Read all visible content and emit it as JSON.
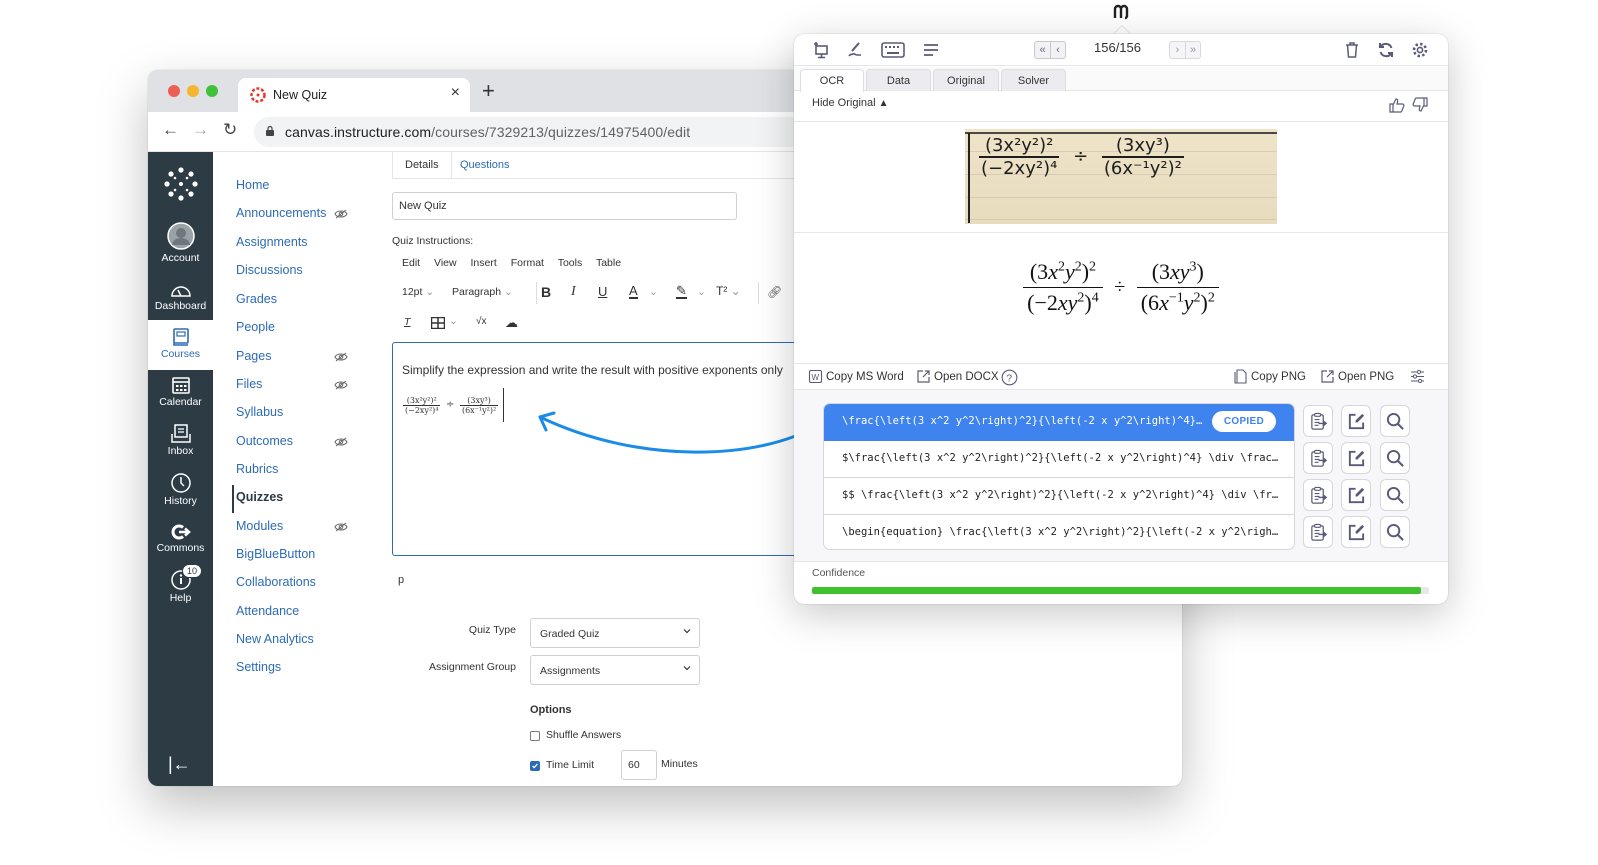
{
  "browser": {
    "tab_title": "New Quiz",
    "new_tab_symbol": "+",
    "close_symbol": "×",
    "url_domain": "canvas.instructure.com",
    "url_path": "/courses/7329213/quizzes/14975400/edit"
  },
  "global_nav": {
    "items": [
      {
        "label": "Account",
        "icon": "account-icon"
      },
      {
        "label": "Dashboard",
        "icon": "dashboard-icon"
      },
      {
        "label": "Courses",
        "icon": "courses-icon",
        "active": true
      },
      {
        "label": "Calendar",
        "icon": "calendar-icon"
      },
      {
        "label": "Inbox",
        "icon": "inbox-icon"
      },
      {
        "label": "History",
        "icon": "history-icon"
      },
      {
        "label": "Commons",
        "icon": "commons-icon"
      },
      {
        "label": "Help",
        "icon": "help-icon"
      }
    ],
    "help_badge": "10"
  },
  "course_nav": {
    "items": [
      {
        "label": "Home",
        "hidden": false
      },
      {
        "label": "Announcements",
        "hidden": true
      },
      {
        "label": "Assignments",
        "hidden": false
      },
      {
        "label": "Discussions",
        "hidden": false
      },
      {
        "label": "Grades",
        "hidden": false
      },
      {
        "label": "People",
        "hidden": false
      },
      {
        "label": "Pages",
        "hidden": true
      },
      {
        "label": "Files",
        "hidden": true
      },
      {
        "label": "Syllabus",
        "hidden": false
      },
      {
        "label": "Outcomes",
        "hidden": true
      },
      {
        "label": "Rubrics",
        "hidden": false
      },
      {
        "label": "Quizzes",
        "hidden": false,
        "active": true
      },
      {
        "label": "Modules",
        "hidden": true
      },
      {
        "label": "BigBlueButton",
        "hidden": false
      },
      {
        "label": "Collaborations",
        "hidden": false
      },
      {
        "label": "Attendance",
        "hidden": false
      },
      {
        "label": "New Analytics",
        "hidden": false
      },
      {
        "label": "Settings",
        "hidden": false
      }
    ]
  },
  "quiz_editor": {
    "tabs": [
      "Details",
      "Questions"
    ],
    "title_value": "New Quiz",
    "instructions_label": "Quiz Instructions:",
    "menu": [
      "Edit",
      "View",
      "Insert",
      "Format",
      "Tools",
      "Table"
    ],
    "font_size": "12pt",
    "block_format": "Paragraph",
    "body_text": "Simplify the expression and write the result with positive exponents only",
    "math": {
      "num1": "(3x²y²)²",
      "den1": "(−2xy²)⁴",
      "op": "÷",
      "num2": "(3xy³)",
      "den2": "(6x⁻¹y²)²"
    },
    "status_path": "p",
    "quiz_type_label": "Quiz Type",
    "quiz_type_value": "Graded Quiz",
    "assignment_group_label": "Assignment Group",
    "assignment_group_value": "Assignments",
    "options_heading": "Options",
    "shuffle_label": "Shuffle Answers",
    "shuffle_checked": false,
    "time_limit_label": "Time Limit",
    "time_limit_checked": true,
    "time_limit_value": "60",
    "minutes_label": "Minutes"
  },
  "snip": {
    "pager": "156/156",
    "tabs": [
      "OCR",
      "Data",
      "Original",
      "Solver"
    ],
    "active_tab": "OCR",
    "hide_original": "Hide Original",
    "actions": {
      "copy_word": "Copy MS Word",
      "open_docx": "Open DOCX",
      "copy_png": "Copy PNG",
      "open_png": "Open PNG"
    },
    "results": [
      {
        "text": "\\frac{\\left(3 x^2 y^2\\right)^2}{\\left(-2 x y^2\\right)^4}…",
        "selected": true
      },
      {
        "text": "$\\frac{\\left(3 x^2 y^2\\right)^2}{\\left(-2 x y^2\\right)^4} \\div \\frac…",
        "selected": false
      },
      {
        "text": "$$ \\frac{\\left(3 x^2 y^2\\right)^2}{\\left(-2 x y^2\\right)^4} \\div \\fr…",
        "selected": false
      },
      {
        "text": "\\begin{equation} \\frac{\\left(3 x^2 y^2\\right)^2}{\\left(-2 x y^2\\righ…",
        "selected": false
      }
    ],
    "copied_badge": "COPIED",
    "confidence_label": "Confidence",
    "confidence_percent": 98.7,
    "colors": {
      "accent": "#3f83ee",
      "confidence": "#42c12f"
    }
  }
}
